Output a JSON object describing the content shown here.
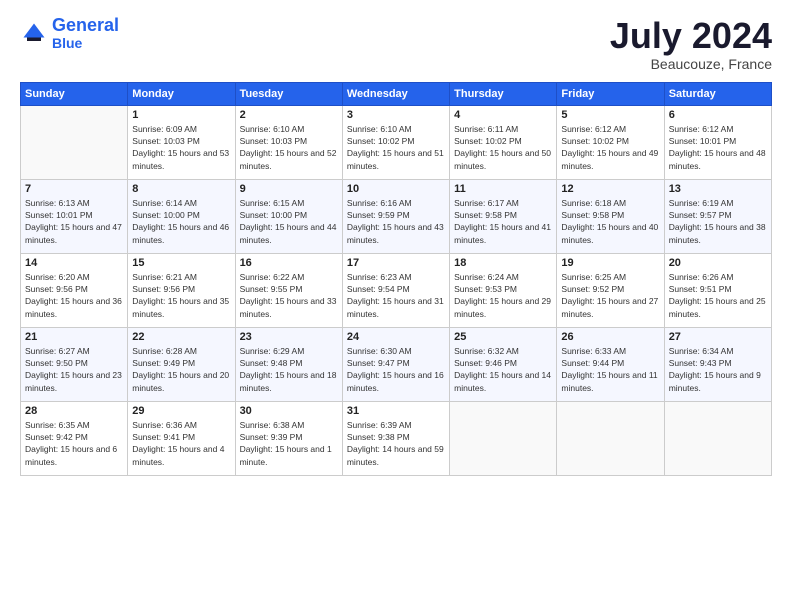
{
  "header": {
    "logo_line1": "General",
    "logo_line2": "Blue",
    "title": "July 2024",
    "location": "Beaucouze, France"
  },
  "weekdays": [
    "Sunday",
    "Monday",
    "Tuesday",
    "Wednesday",
    "Thursday",
    "Friday",
    "Saturday"
  ],
  "weeks": [
    [
      {
        "day": "",
        "empty": true
      },
      {
        "day": "1",
        "sunrise": "6:09 AM",
        "sunset": "10:03 PM",
        "daylight": "15 hours and 53 minutes."
      },
      {
        "day": "2",
        "sunrise": "6:10 AM",
        "sunset": "10:03 PM",
        "daylight": "15 hours and 52 minutes."
      },
      {
        "day": "3",
        "sunrise": "6:10 AM",
        "sunset": "10:02 PM",
        "daylight": "15 hours and 51 minutes."
      },
      {
        "day": "4",
        "sunrise": "6:11 AM",
        "sunset": "10:02 PM",
        "daylight": "15 hours and 50 minutes."
      },
      {
        "day": "5",
        "sunrise": "6:12 AM",
        "sunset": "10:02 PM",
        "daylight": "15 hours and 49 minutes."
      },
      {
        "day": "6",
        "sunrise": "6:12 AM",
        "sunset": "10:01 PM",
        "daylight": "15 hours and 48 minutes."
      }
    ],
    [
      {
        "day": "7",
        "sunrise": "6:13 AM",
        "sunset": "10:01 PM",
        "daylight": "15 hours and 47 minutes."
      },
      {
        "day": "8",
        "sunrise": "6:14 AM",
        "sunset": "10:00 PM",
        "daylight": "15 hours and 46 minutes."
      },
      {
        "day": "9",
        "sunrise": "6:15 AM",
        "sunset": "10:00 PM",
        "daylight": "15 hours and 44 minutes."
      },
      {
        "day": "10",
        "sunrise": "6:16 AM",
        "sunset": "9:59 PM",
        "daylight": "15 hours and 43 minutes."
      },
      {
        "day": "11",
        "sunrise": "6:17 AM",
        "sunset": "9:58 PM",
        "daylight": "15 hours and 41 minutes."
      },
      {
        "day": "12",
        "sunrise": "6:18 AM",
        "sunset": "9:58 PM",
        "daylight": "15 hours and 40 minutes."
      },
      {
        "day": "13",
        "sunrise": "6:19 AM",
        "sunset": "9:57 PM",
        "daylight": "15 hours and 38 minutes."
      }
    ],
    [
      {
        "day": "14",
        "sunrise": "6:20 AM",
        "sunset": "9:56 PM",
        "daylight": "15 hours and 36 minutes."
      },
      {
        "day": "15",
        "sunrise": "6:21 AM",
        "sunset": "9:56 PM",
        "daylight": "15 hours and 35 minutes."
      },
      {
        "day": "16",
        "sunrise": "6:22 AM",
        "sunset": "9:55 PM",
        "daylight": "15 hours and 33 minutes."
      },
      {
        "day": "17",
        "sunrise": "6:23 AM",
        "sunset": "9:54 PM",
        "daylight": "15 hours and 31 minutes."
      },
      {
        "day": "18",
        "sunrise": "6:24 AM",
        "sunset": "9:53 PM",
        "daylight": "15 hours and 29 minutes."
      },
      {
        "day": "19",
        "sunrise": "6:25 AM",
        "sunset": "9:52 PM",
        "daylight": "15 hours and 27 minutes."
      },
      {
        "day": "20",
        "sunrise": "6:26 AM",
        "sunset": "9:51 PM",
        "daylight": "15 hours and 25 minutes."
      }
    ],
    [
      {
        "day": "21",
        "sunrise": "6:27 AM",
        "sunset": "9:50 PM",
        "daylight": "15 hours and 23 minutes."
      },
      {
        "day": "22",
        "sunrise": "6:28 AM",
        "sunset": "9:49 PM",
        "daylight": "15 hours and 20 minutes."
      },
      {
        "day": "23",
        "sunrise": "6:29 AM",
        "sunset": "9:48 PM",
        "daylight": "15 hours and 18 minutes."
      },
      {
        "day": "24",
        "sunrise": "6:30 AM",
        "sunset": "9:47 PM",
        "daylight": "15 hours and 16 minutes."
      },
      {
        "day": "25",
        "sunrise": "6:32 AM",
        "sunset": "9:46 PM",
        "daylight": "15 hours and 14 minutes."
      },
      {
        "day": "26",
        "sunrise": "6:33 AM",
        "sunset": "9:44 PM",
        "daylight": "15 hours and 11 minutes."
      },
      {
        "day": "27",
        "sunrise": "6:34 AM",
        "sunset": "9:43 PM",
        "daylight": "15 hours and 9 minutes."
      }
    ],
    [
      {
        "day": "28",
        "sunrise": "6:35 AM",
        "sunset": "9:42 PM",
        "daylight": "15 hours and 6 minutes."
      },
      {
        "day": "29",
        "sunrise": "6:36 AM",
        "sunset": "9:41 PM",
        "daylight": "15 hours and 4 minutes."
      },
      {
        "day": "30",
        "sunrise": "6:38 AM",
        "sunset": "9:39 PM",
        "daylight": "15 hours and 1 minute."
      },
      {
        "day": "31",
        "sunrise": "6:39 AM",
        "sunset": "9:38 PM",
        "daylight": "14 hours and 59 minutes."
      },
      {
        "day": "",
        "empty": true
      },
      {
        "day": "",
        "empty": true
      },
      {
        "day": "",
        "empty": true
      }
    ]
  ]
}
